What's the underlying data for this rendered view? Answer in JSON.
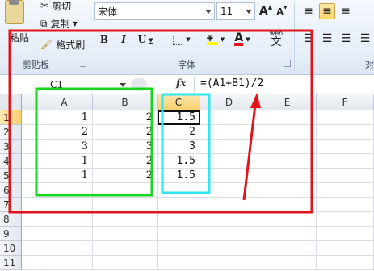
{
  "ribbon": {
    "clipboard": {
      "paste_label": "粘贴",
      "cut_label": "剪切",
      "copy_label": "复制",
      "format_painter_label": "格式刷",
      "group_label": "剪贴板"
    },
    "font": {
      "font_name": "宋体",
      "font_size": "11",
      "grow_label": "A",
      "shrink_label": "A",
      "bold_label": "B",
      "italic_label": "I",
      "underline_label": "U",
      "font_color_label": "A",
      "phonetic_label": "wén",
      "phonetic_char": "文",
      "group_label": "字体"
    },
    "align": {
      "group_label": "对"
    }
  },
  "formula_bar": {
    "name_box": "C1",
    "fx_label": "fx",
    "formula": "=(A1+B1)/2"
  },
  "grid": {
    "columns": [
      "A",
      "B",
      "C",
      "D",
      "E",
      "F"
    ],
    "rows": [
      "1",
      "2",
      "3",
      "4",
      "5",
      "6",
      "7",
      "8",
      "9",
      "10",
      "11"
    ],
    "data": [
      [
        "1",
        "2",
        "1.5"
      ],
      [
        "2",
        "2",
        "2"
      ],
      [
        "3",
        "3",
        "3"
      ],
      [
        "1",
        "2",
        "1.5"
      ],
      [
        "1",
        "2",
        "1.5"
      ]
    ],
    "selected_cell": "C1"
  },
  "colors": {
    "red_annotation": "#e0141a",
    "green_annotation": "#19d51c",
    "cyan_annotation": "#2fe6f2",
    "header_selected": "#f8cf6e"
  }
}
